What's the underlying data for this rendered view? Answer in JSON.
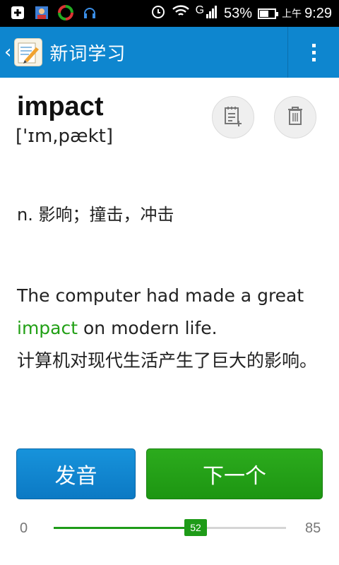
{
  "status_bar": {
    "battery_percent": "53%",
    "time_prefix": "上午",
    "time": "9:29",
    "network": "G",
    "icons": [
      "notification-plus-icon",
      "contacts-icon",
      "app-icon",
      "headset-icon",
      "alarm-icon",
      "wifi-icon",
      "signal-icon",
      "battery-icon"
    ]
  },
  "app_bar": {
    "title": "新词学习",
    "back_icon": "chevron-left-icon",
    "menu_icon": "overflow-menu-icon"
  },
  "word": {
    "text": "impact",
    "phonetic": "['ɪm,pækt]"
  },
  "actions": {
    "note_icon": "add-note-icon",
    "delete_icon": "trash-icon"
  },
  "definition": "n. 影响；撞击，冲击",
  "example": {
    "before": "The computer had made a great ",
    "highlight": "impact",
    "after": " on modern life.",
    "translation": "计算机对现代生活产生了巨大的影响。"
  },
  "buttons": {
    "pronounce": "发音",
    "next": "下一个"
  },
  "progress": {
    "min": "0",
    "max": "85",
    "current": "52",
    "current_value": 52,
    "max_value": 85
  },
  "colors": {
    "app_bar": "#0e86cf",
    "highlight": "#22a016",
    "next_button": "#22a016",
    "pronounce_button": "#0e86cf"
  }
}
